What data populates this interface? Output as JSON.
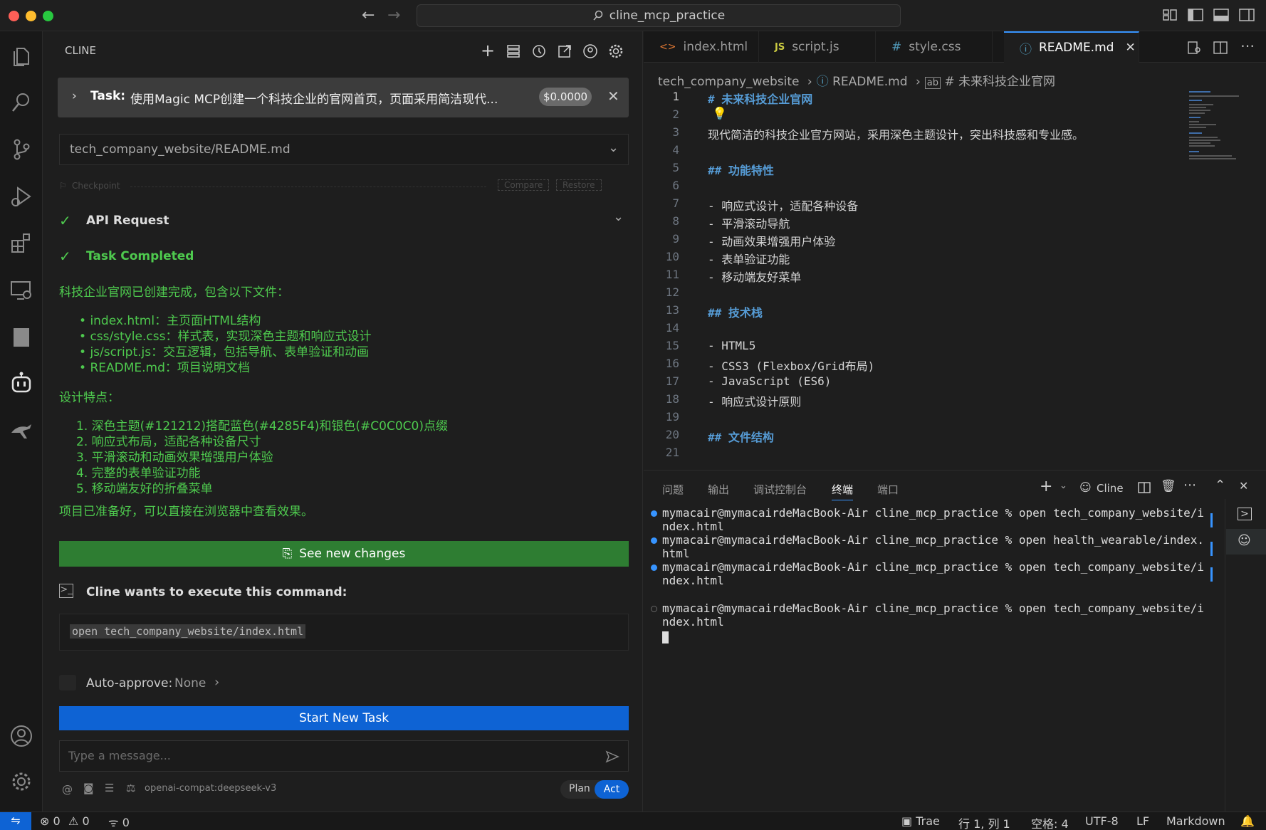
{
  "titlebar": {
    "search_text": "cline_mcp_practice",
    "colors": {
      "close": "#ff5f57",
      "min": "#febc2e",
      "max": "#28c840"
    }
  },
  "activity_icons": [
    "files-icon",
    "search-icon",
    "source-control-icon",
    "run-debug-icon",
    "extensions-icon",
    "remote-explorer-icon",
    "bookmark-icon",
    "cline-robot-icon",
    "kangaroo-icon",
    "account-icon",
    "settings-gear-icon"
  ],
  "cline": {
    "title": "CLINE",
    "task_label": "Task:",
    "task_text": "使用Magic MCP创建一个科技企业的官网首页，页面采用简洁现代...",
    "cost": "$0.0000",
    "file_path": "tech_company_website/README.md",
    "checkpoint": "Checkpoint",
    "compare": "Compare",
    "restore": "Restore",
    "api_request": "API Request",
    "task_completed": "Task Completed",
    "summary": "科技企业官网已创建完成，包含以下文件：",
    "files": [
      "index.html：主页面HTML结构",
      "css/style.css：样式表，实现深色主题和响应式设计",
      "js/script.js：交互逻辑，包括导航、表单验证和动画",
      "README.md：项目说明文档"
    ],
    "design_title": "设计特点：",
    "design": [
      "1. 深色主题(#121212)搭配蓝色(#4285F4)和银色(#C0C0C0)点缀",
      "2. 响应式布局，适配各种设备尺寸",
      "3. 平滑滚动和动画效果增强用户体验",
      "4. 完整的表单验证功能",
      "5. 移动端友好的折叠菜单"
    ],
    "ready": "项目已准备好，可以直接在浏览器中查看效果。",
    "see_changes": "See new changes",
    "execute_title": "Cline wants to execute this command:",
    "command": "open tech_company_website/index.html",
    "auto_approve_label": "Auto-approve:",
    "auto_approve_value": "None",
    "start_new_task": "Start New Task",
    "input_placeholder": "Type a message...",
    "model": "openai-compat:deepseek-v3",
    "plan": "Plan",
    "act": "Act"
  },
  "editor": {
    "tabs": [
      {
        "icon": "<>",
        "label": "index.html",
        "color": "#e37933"
      },
      {
        "icon": "JS",
        "label": "script.js",
        "color": "#cbcb41"
      },
      {
        "icon": "#",
        "label": "style.css",
        "color": "#519aba"
      },
      {
        "icon": "ⓘ",
        "label": "README.md",
        "color": "#519aba"
      }
    ],
    "breadcrumb": [
      "tech_company_website",
      "README.md",
      "# 未来科技企业官网"
    ],
    "lines": [
      {
        "n": "1",
        "t": "# 未来科技企业官网",
        "h": true
      },
      {
        "n": "2",
        "t": "",
        "h": false
      },
      {
        "n": "3",
        "t": "现代简洁的科技企业官方网站，采用深色主题设计，突出科技感和专业感。",
        "h": false
      },
      {
        "n": "4",
        "t": "",
        "h": false
      },
      {
        "n": "5",
        "t": "## 功能特性",
        "h": true
      },
      {
        "n": "6",
        "t": "",
        "h": false
      },
      {
        "n": "7",
        "t": "- 响应式设计，适配各种设备",
        "h": false
      },
      {
        "n": "8",
        "t": "- 平滑滚动导航",
        "h": false
      },
      {
        "n": "9",
        "t": "- 动画效果增强用户体验",
        "h": false
      },
      {
        "n": "10",
        "t": "- 表单验证功能",
        "h": false
      },
      {
        "n": "11",
        "t": "- 移动端友好菜单",
        "h": false
      },
      {
        "n": "12",
        "t": "",
        "h": false
      },
      {
        "n": "13",
        "t": "## 技术栈",
        "h": true
      },
      {
        "n": "14",
        "t": "",
        "h": false
      },
      {
        "n": "15",
        "t": "- HTML5",
        "h": false
      },
      {
        "n": "16",
        "t": "- CSS3 (Flexbox/Grid布局)",
        "h": false
      },
      {
        "n": "17",
        "t": "- JavaScript (ES6)",
        "h": false
      },
      {
        "n": "18",
        "t": "- 响应式设计原则",
        "h": false
      },
      {
        "n": "19",
        "t": "",
        "h": false
      },
      {
        "n": "20",
        "t": "## 文件结构",
        "h": true
      },
      {
        "n": "21",
        "t": "",
        "h": false
      }
    ]
  },
  "terminal": {
    "tabs": [
      "问题",
      "输出",
      "调试控制台",
      "终端",
      "端口"
    ],
    "active_tab": "终端",
    "profile": "Cline",
    "entries": [
      {
        "l1": "mymacair@mymacairdeMacBook-Air cline_mcp_practice % open tech_company_website/i",
        "l2": "ndex.html"
      },
      {
        "l1": "mymacair@mymacairdeMacBook-Air cline_mcp_practice % open health_wearable/index.",
        "l2": "html"
      },
      {
        "l1": "mymacair@mymacairdeMacBook-Air cline_mcp_practice % open tech_company_website/i",
        "l2": "ndex.html"
      },
      {
        "l1": "mymacair@mymacairdeMacBook-Air cline_mcp_practice % open tech_company_website/i",
        "l2": "ndex.html"
      }
    ]
  },
  "status": {
    "errors": "0",
    "warnings": "0",
    "ports": "0",
    "trae": "Trae",
    "position": "行 1, 列 1",
    "spaces": "空格: 4",
    "encoding": "UTF-8",
    "eol": "LF",
    "language": "Markdown"
  }
}
